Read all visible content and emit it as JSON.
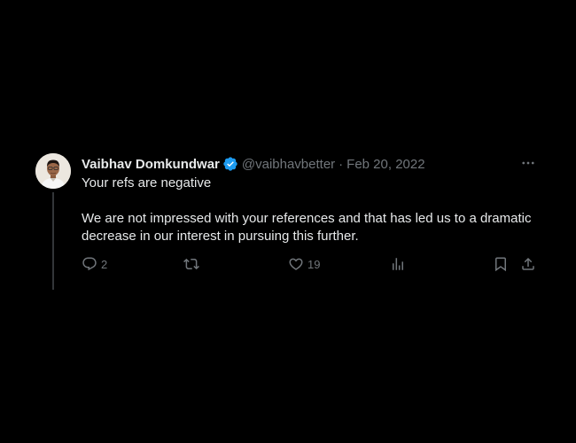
{
  "tweet": {
    "author_name": "Vaibhav Domkundwar",
    "handle": "@vaibhavbetter",
    "separator": "·",
    "date": "Feb 20, 2022",
    "paragraphs": [
      "Your refs are negative",
      "We are not impressed with your references and that has led us to a dramatic decrease in our interest in pursuing this further."
    ],
    "actions": {
      "replies": "2",
      "likes": "19"
    }
  },
  "icons": {
    "verified": "verified-badge-icon",
    "more": "more-options-icon",
    "reply": "reply-icon",
    "retweet": "retweet-icon",
    "like": "heart-icon",
    "views": "analytics-icon",
    "bookmark": "bookmark-icon",
    "share": "share-icon"
  },
  "colors": {
    "background": "#000000",
    "text": "#e7e9ea",
    "secondary": "#71767b",
    "verified": "#1d9bf0"
  }
}
